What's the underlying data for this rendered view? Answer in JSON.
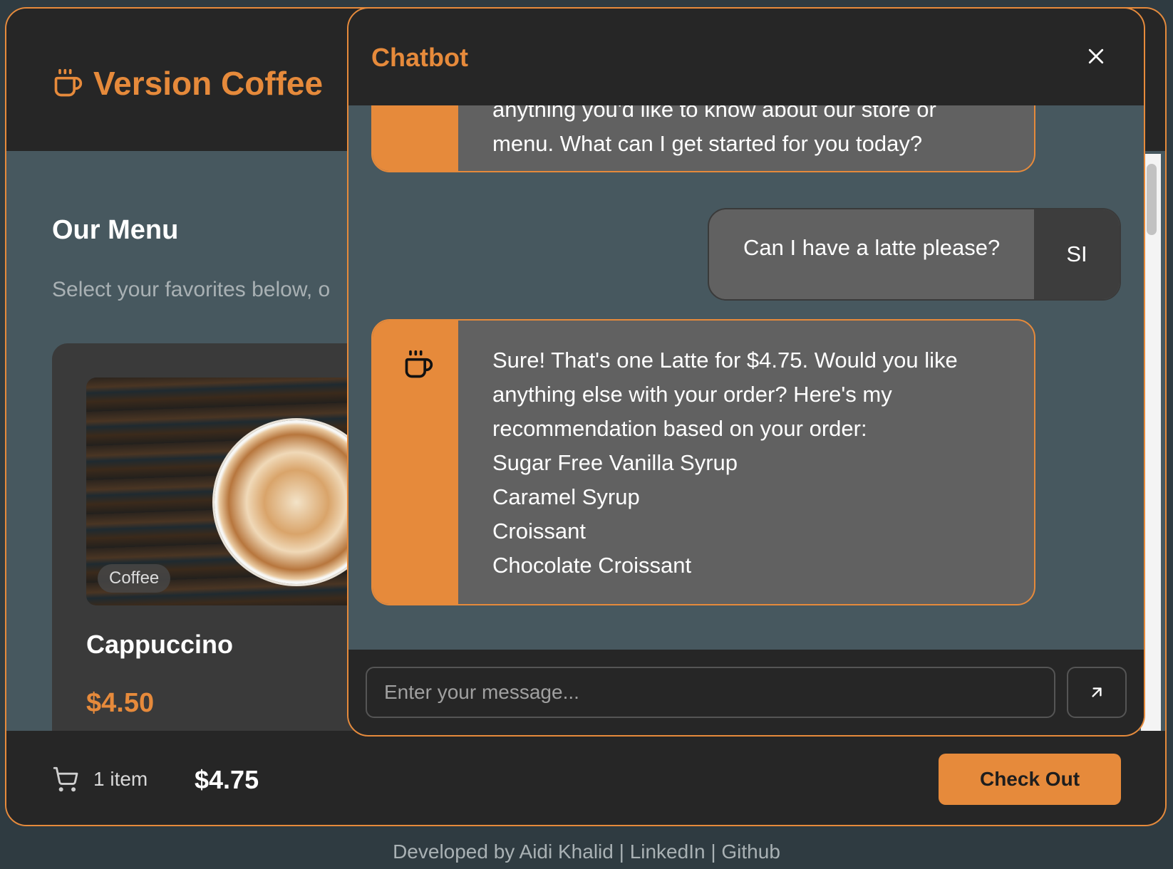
{
  "brand": {
    "title": "Version Coffee",
    "icon": "coffee-cup-icon"
  },
  "menu": {
    "title": "Our Menu",
    "subtitle": "Select your favorites below, o"
  },
  "product": {
    "category": "Coffee",
    "name": "Cappuccino",
    "price": "$4.50"
  },
  "cart": {
    "icon": "cart-icon",
    "count_label": "1 item",
    "total": "$4.75",
    "checkout_label": "Check Out"
  },
  "chatbot": {
    "title": "Chatbot",
    "close_icon": "close-icon",
    "messages": {
      "bot_1": [
        "anything you'd like to know about our store or",
        "menu. What can I get started for you today?"
      ],
      "user_1": {
        "text": "Can I have a latte please?",
        "avatar": "SI"
      },
      "bot_2": [
        "Sure! That's one Latte for $4.75. Would you like",
        "anything else with your order? Here's my",
        "recommendation based on your order:",
        "Sugar Free Vanilla Syrup",
        "Caramel Syrup",
        "Croissant",
        "Chocolate Croissant"
      ]
    },
    "input_placeholder": "Enter your message...",
    "send_icon": "arrow-up-right-icon"
  },
  "credits": {
    "prefix": "Developed by Aidi Khalid",
    "sep": "|",
    "linkedin": "LinkedIn",
    "github": "Github"
  },
  "colors": {
    "accent": "#e68a3b",
    "dark": "#262626",
    "background": "#47585f",
    "bubble": "#616161"
  }
}
